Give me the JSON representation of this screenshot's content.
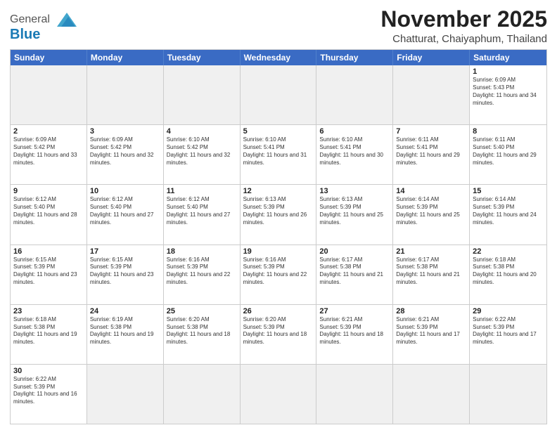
{
  "header": {
    "logo_general": "General",
    "logo_blue": "Blue",
    "month": "November 2025",
    "location": "Chatturat, Chaiyaphum, Thailand"
  },
  "weekdays": [
    "Sunday",
    "Monday",
    "Tuesday",
    "Wednesday",
    "Thursday",
    "Friday",
    "Saturday"
  ],
  "rows": [
    [
      {
        "day": "",
        "empty": true
      },
      {
        "day": "",
        "empty": true
      },
      {
        "day": "",
        "empty": true
      },
      {
        "day": "",
        "empty": true
      },
      {
        "day": "",
        "empty": true
      },
      {
        "day": "",
        "empty": true
      },
      {
        "day": "1",
        "sunrise": "Sunrise: 6:09 AM",
        "sunset": "Sunset: 5:43 PM",
        "daylight": "Daylight: 11 hours and 34 minutes."
      }
    ],
    [
      {
        "day": "2",
        "sunrise": "Sunrise: 6:09 AM",
        "sunset": "Sunset: 5:42 PM",
        "daylight": "Daylight: 11 hours and 33 minutes."
      },
      {
        "day": "3",
        "sunrise": "Sunrise: 6:09 AM",
        "sunset": "Sunset: 5:42 PM",
        "daylight": "Daylight: 11 hours and 32 minutes."
      },
      {
        "day": "4",
        "sunrise": "Sunrise: 6:10 AM",
        "sunset": "Sunset: 5:42 PM",
        "daylight": "Daylight: 11 hours and 32 minutes."
      },
      {
        "day": "5",
        "sunrise": "Sunrise: 6:10 AM",
        "sunset": "Sunset: 5:41 PM",
        "daylight": "Daylight: 11 hours and 31 minutes."
      },
      {
        "day": "6",
        "sunrise": "Sunrise: 6:10 AM",
        "sunset": "Sunset: 5:41 PM",
        "daylight": "Daylight: 11 hours and 30 minutes."
      },
      {
        "day": "7",
        "sunrise": "Sunrise: 6:11 AM",
        "sunset": "Sunset: 5:41 PM",
        "daylight": "Daylight: 11 hours and 29 minutes."
      },
      {
        "day": "8",
        "sunrise": "Sunrise: 6:11 AM",
        "sunset": "Sunset: 5:40 PM",
        "daylight": "Daylight: 11 hours and 29 minutes."
      }
    ],
    [
      {
        "day": "9",
        "sunrise": "Sunrise: 6:12 AM",
        "sunset": "Sunset: 5:40 PM",
        "daylight": "Daylight: 11 hours and 28 minutes."
      },
      {
        "day": "10",
        "sunrise": "Sunrise: 6:12 AM",
        "sunset": "Sunset: 5:40 PM",
        "daylight": "Daylight: 11 hours and 27 minutes."
      },
      {
        "day": "11",
        "sunrise": "Sunrise: 6:12 AM",
        "sunset": "Sunset: 5:40 PM",
        "daylight": "Daylight: 11 hours and 27 minutes."
      },
      {
        "day": "12",
        "sunrise": "Sunrise: 6:13 AM",
        "sunset": "Sunset: 5:39 PM",
        "daylight": "Daylight: 11 hours and 26 minutes."
      },
      {
        "day": "13",
        "sunrise": "Sunrise: 6:13 AM",
        "sunset": "Sunset: 5:39 PM",
        "daylight": "Daylight: 11 hours and 25 minutes."
      },
      {
        "day": "14",
        "sunrise": "Sunrise: 6:14 AM",
        "sunset": "Sunset: 5:39 PM",
        "daylight": "Daylight: 11 hours and 25 minutes."
      },
      {
        "day": "15",
        "sunrise": "Sunrise: 6:14 AM",
        "sunset": "Sunset: 5:39 PM",
        "daylight": "Daylight: 11 hours and 24 minutes."
      }
    ],
    [
      {
        "day": "16",
        "sunrise": "Sunrise: 6:15 AM",
        "sunset": "Sunset: 5:39 PM",
        "daylight": "Daylight: 11 hours and 23 minutes."
      },
      {
        "day": "17",
        "sunrise": "Sunrise: 6:15 AM",
        "sunset": "Sunset: 5:39 PM",
        "daylight": "Daylight: 11 hours and 23 minutes."
      },
      {
        "day": "18",
        "sunrise": "Sunrise: 6:16 AM",
        "sunset": "Sunset: 5:39 PM",
        "daylight": "Daylight: 11 hours and 22 minutes."
      },
      {
        "day": "19",
        "sunrise": "Sunrise: 6:16 AM",
        "sunset": "Sunset: 5:39 PM",
        "daylight": "Daylight: 11 hours and 22 minutes."
      },
      {
        "day": "20",
        "sunrise": "Sunrise: 6:17 AM",
        "sunset": "Sunset: 5:38 PM",
        "daylight": "Daylight: 11 hours and 21 minutes."
      },
      {
        "day": "21",
        "sunrise": "Sunrise: 6:17 AM",
        "sunset": "Sunset: 5:38 PM",
        "daylight": "Daylight: 11 hours and 21 minutes."
      },
      {
        "day": "22",
        "sunrise": "Sunrise: 6:18 AM",
        "sunset": "Sunset: 5:38 PM",
        "daylight": "Daylight: 11 hours and 20 minutes."
      }
    ],
    [
      {
        "day": "23",
        "sunrise": "Sunrise: 6:18 AM",
        "sunset": "Sunset: 5:38 PM",
        "daylight": "Daylight: 11 hours and 19 minutes."
      },
      {
        "day": "24",
        "sunrise": "Sunrise: 6:19 AM",
        "sunset": "Sunset: 5:38 PM",
        "daylight": "Daylight: 11 hours and 19 minutes."
      },
      {
        "day": "25",
        "sunrise": "Sunrise: 6:20 AM",
        "sunset": "Sunset: 5:38 PM",
        "daylight": "Daylight: 11 hours and 18 minutes."
      },
      {
        "day": "26",
        "sunrise": "Sunrise: 6:20 AM",
        "sunset": "Sunset: 5:39 PM",
        "daylight": "Daylight: 11 hours and 18 minutes."
      },
      {
        "day": "27",
        "sunrise": "Sunrise: 6:21 AM",
        "sunset": "Sunset: 5:39 PM",
        "daylight": "Daylight: 11 hours and 18 minutes."
      },
      {
        "day": "28",
        "sunrise": "Sunrise: 6:21 AM",
        "sunset": "Sunset: 5:39 PM",
        "daylight": "Daylight: 11 hours and 17 minutes."
      },
      {
        "day": "29",
        "sunrise": "Sunrise: 6:22 AM",
        "sunset": "Sunset: 5:39 PM",
        "daylight": "Daylight: 11 hours and 17 minutes."
      }
    ],
    [
      {
        "day": "30",
        "sunrise": "Sunrise: 6:22 AM",
        "sunset": "Sunset: 5:39 PM",
        "daylight": "Daylight: 11 hours and 16 minutes."
      },
      {
        "day": "",
        "empty": true
      },
      {
        "day": "",
        "empty": true
      },
      {
        "day": "",
        "empty": true
      },
      {
        "day": "",
        "empty": true
      },
      {
        "day": "",
        "empty": true
      },
      {
        "day": "",
        "empty": true
      }
    ]
  ]
}
